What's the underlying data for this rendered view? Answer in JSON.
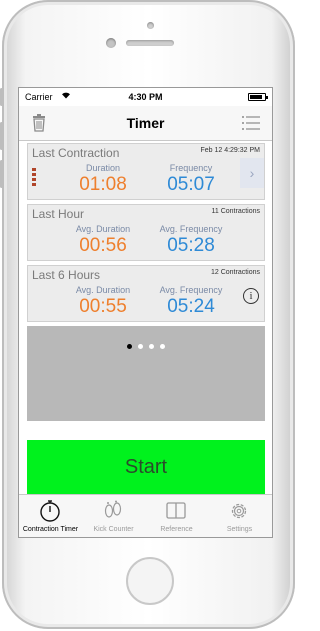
{
  "status_bar": {
    "carrier": "Carrier",
    "time": "4:30 PM",
    "battery_level": 0.85
  },
  "nav": {
    "title": "Timer",
    "left_icon": "trash-icon",
    "right_icon": "list-icon"
  },
  "cards": {
    "last_contraction": {
      "title": "Last Contraction",
      "timestamp": "Feb 12 4:29:32 PM",
      "duration_label": "Duration",
      "duration_value": "01:08",
      "frequency_label": "Frequency",
      "frequency_value": "05:07"
    },
    "last_hour": {
      "title": "Last Hour",
      "count": "11 Contractions",
      "duration_label": "Avg. Duration",
      "duration_value": "00:56",
      "frequency_label": "Avg. Frequency",
      "frequency_value": "05:28"
    },
    "last_6_hours": {
      "title": "Last 6 Hours",
      "count": "12 Contractions",
      "duration_label": "Avg. Duration",
      "duration_value": "00:55",
      "frequency_label": "Avg. Frequency",
      "frequency_value": "05:24"
    }
  },
  "page_indicator": {
    "pages": 4,
    "current": 1
  },
  "start_button": {
    "label": "Start",
    "color": "#00f21d"
  },
  "tabs": [
    {
      "label": "Contraction Timer",
      "icon": "stopwatch-icon",
      "active": true
    },
    {
      "label": "Kick Counter",
      "icon": "footprints-icon",
      "active": false
    },
    {
      "label": "Reference",
      "icon": "book-icon",
      "active": false
    },
    {
      "label": "Settings",
      "icon": "gear-icon",
      "active": false
    }
  ],
  "colors": {
    "duration": "#ee7f2d",
    "frequency": "#2e8ad6",
    "accent_green": "#00f21d"
  }
}
